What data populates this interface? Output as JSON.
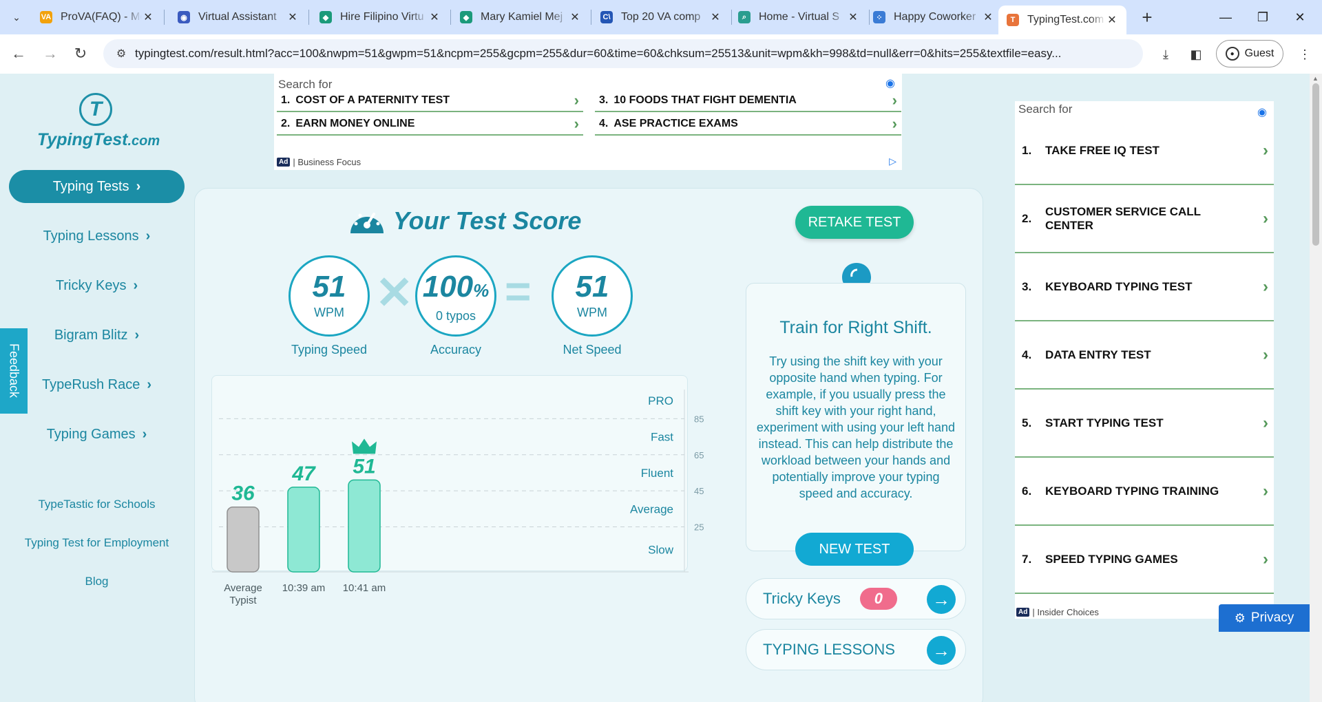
{
  "browser": {
    "tabs": [
      {
        "title": "ProVA(FAQ) - Me",
        "fav": "VA",
        "favColor": "#f2a20c",
        "left": 46,
        "width": 190
      },
      {
        "title": "Virtual Assistant",
        "fav": "◉",
        "favColor": "#3b5bbf",
        "left": 246,
        "width": 200
      },
      {
        "title": "Hire Filipino Virtu",
        "fav": "◆",
        "favColor": "#1b9a7a",
        "left": 452,
        "width": 200
      },
      {
        "title": "Mary Kamiel Mej",
        "fav": "◆",
        "favColor": "#1b9a7a",
        "left": 656,
        "width": 200
      },
      {
        "title": "Top 20 VA comp",
        "fav": "C\\",
        "favColor": "#2456b5",
        "left": 860,
        "width": 200
      },
      {
        "title": "Home - Virtual S",
        "fav": "⌕",
        "favColor": "#2a9d8f",
        "left": 1060,
        "width": 200
      },
      {
        "title": "Happy Coworker",
        "fav": "⁘",
        "favColor": "#3a7bd5",
        "left": 1256,
        "width": 200
      },
      {
        "title": "TypingTest.com",
        "fav": "T",
        "favColor": "#e8743b",
        "left": 1450,
        "width": 186,
        "active": true
      }
    ],
    "url": "typingtest.com/result.html?acc=100&nwpm=51&gwpm=51&ncpm=255&gcpm=255&dur=60&time=60&chksum=25513&unit=wpm&kh=998&td=null&err=0&hits=255&textfile=easy...",
    "guest_label": "Guest"
  },
  "logo": {
    "name": "TypingTest",
    "tld": ".com"
  },
  "sidebar": {
    "items": [
      {
        "label": "Typing Tests",
        "active": true
      },
      {
        "label": "Typing Lessons"
      },
      {
        "label": "Tricky Keys"
      },
      {
        "label": "Bigram Blitz"
      },
      {
        "label": "TypeRush Race"
      },
      {
        "label": "Typing Games"
      }
    ],
    "links": [
      "TypeTastic for Schools",
      "Typing Test for Employment",
      "Blog"
    ],
    "feedback": "Feedback"
  },
  "ad_top": {
    "search_for": "Search for",
    "items": [
      {
        "num": "1.",
        "label": "COST OF A PATERNITY TEST"
      },
      {
        "num": "3.",
        "label": "10 FOODS THAT FIGHT DEMENTIA"
      },
      {
        "num": "2.",
        "label": "EARN MONEY ONLINE"
      },
      {
        "num": "4.",
        "label": "ASE PRACTICE EXAMS"
      }
    ],
    "badge": "Ad",
    "sponsor": "| Business Focus"
  },
  "score": {
    "title": "Your Test Score",
    "retake": "RETAKE TEST",
    "speed": {
      "value": "51",
      "unit": "WPM",
      "caption": "Typing Speed"
    },
    "accuracy": {
      "value": "100",
      "pct": "%",
      "sub": "0 typos",
      "caption": "Accuracy"
    },
    "net": {
      "value": "51",
      "unit": "WPM",
      "caption": "Net Speed"
    }
  },
  "chart_data": {
    "type": "bar",
    "categories": [
      "Average Typist",
      "10:39 am",
      "10:41 am"
    ],
    "values": [
      36,
      47,
      51
    ],
    "ylim": [
      0,
      105
    ],
    "ticks": [
      25,
      45,
      65,
      85
    ],
    "bands": [
      "Slow",
      "Average",
      "Fluent",
      "Fast",
      "PRO"
    ],
    "colors": {
      "average": "#c8c8c8",
      "user": "#8ee8d4",
      "user_stroke": "#1fb894",
      "label": "#1fb894"
    },
    "best_index": 2
  },
  "tip": {
    "heading": "Train for Right Shift.",
    "body": "Try using the shift key with your opposite hand when typing. For example, if you usually press the shift key with your right hand, experiment with using your left hand instead. This can help distribute the workload between your hands and potentially improve your typing speed and accuracy.",
    "new_test": "NEW TEST"
  },
  "links": {
    "tricky": {
      "label": "Tricky Keys",
      "count": "0"
    },
    "lessons": {
      "label": "TYPING LESSONS"
    }
  },
  "ad_right": {
    "search_for": "Search for",
    "items": [
      {
        "num": "1.",
        "label": "TAKE FREE IQ TEST"
      },
      {
        "num": "2.",
        "label": "CUSTOMER SERVICE CALL CENTER"
      },
      {
        "num": "3.",
        "label": "KEYBOARD TYPING TEST"
      },
      {
        "num": "4.",
        "label": "DATA ENTRY TEST"
      },
      {
        "num": "5.",
        "label": "START TYPING TEST"
      },
      {
        "num": "6.",
        "label": "KEYBOARD TYPING TRAINING"
      },
      {
        "num": "7.",
        "label": "SPEED TYPING GAMES"
      }
    ],
    "badge": "Ad",
    "sponsor": "| Insider Choices"
  },
  "privacy": "Privacy"
}
